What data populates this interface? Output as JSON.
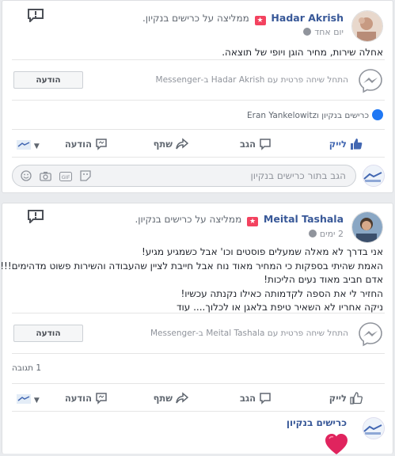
{
  "colors": {
    "link": "#385898",
    "like_blue": "#4267b2",
    "badge_red": "#f3425f",
    "muted": "#90949c",
    "heart": "#e0245e"
  },
  "post1": {
    "author": "Hadar Akrish",
    "recommends": "ממליצה על כרישים בנקיון.",
    "time": "יום אחד",
    "text": "אחלה שירות, מחיר הוגן ויופי של תוצאה.",
    "messenger_text": "התחל שיחה פרטית עם Hadar Akrish ב-Messenger",
    "message_button": "הודעה",
    "likes": "כרישים בנקיון וEran Yankelowitz",
    "actions": {
      "like": "לייק",
      "comment": "הגב",
      "share": "שתף",
      "message": "הודעה"
    },
    "comment_placeholder": "הגב בתור כרישים בנקיון"
  },
  "post2": {
    "author": "Meital Tashala",
    "recommends": "ממליצה על כרישים בנקיון.",
    "time": "2 ימים",
    "lines": [
      "אני בדרך לא מאלה שמעלים פוסטים וכו' אבל כשמגיע מגיע!",
      "האמת שהיתי בספקות כי המחיר מאוד נוח אבל חייבת לציין שהעבודה והשירות פשוט מדהימים!!!",
      "אדם חביב מאוד נעים הליכות!",
      "החזיר לי את הספה לקדמותה כאילו נקנתה עכשיו!",
      "ניקה אחריו לא השאיר טיפת בלאגן או לכלוך.... עוד"
    ],
    "messenger_text": "התחל שיחה פרטית עם Meital Tashala ב-Messenger",
    "message_button": "הודעה",
    "comments_count": "1 תגובה",
    "actions": {
      "like": "לייק",
      "comment": "הגב",
      "share": "שתף",
      "message": "הודעה"
    },
    "reply_author": "כרישים בנקיון",
    "reply_content": "heart-emoji"
  }
}
